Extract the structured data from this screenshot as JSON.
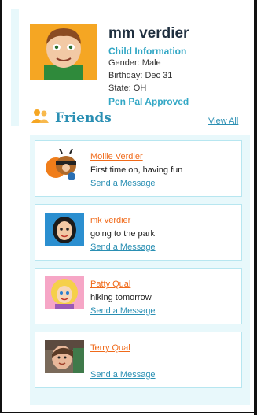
{
  "profile": {
    "name": "mm verdier",
    "child_info_label": "Child Information",
    "gender": "Gender: Male",
    "birthday": "Birthday: Dec 31",
    "state": "State: OH",
    "pen_pal": "Pen Pal Approved"
  },
  "friends": {
    "title": "Friends",
    "view_all": "View All",
    "send_label": "Send a Message",
    "items": [
      {
        "name": "Mollie Verdier",
        "status": "First time on, having fun",
        "avatar": "bee-costume-avatar"
      },
      {
        "name": "mk verdier",
        "status": "going to the park",
        "avatar": "girl-avatar"
      },
      {
        "name": "Patty Qual",
        "status": "hiking tomorrow",
        "avatar": "blonde-girl-avatar"
      },
      {
        "name": "Terry Qual",
        "status": "",
        "avatar": "child-photo-avatar"
      }
    ]
  },
  "colors": {
    "accent_teal": "#2a8fb3",
    "link_orange": "#f06a1a",
    "panel_bg": "#e8f8fb"
  }
}
